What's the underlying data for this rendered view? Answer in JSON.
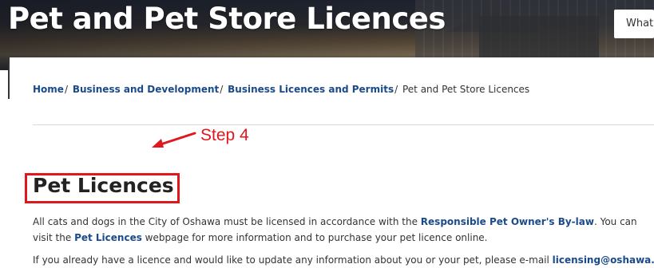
{
  "hero": {
    "title": "Pet and Pet Store Licences"
  },
  "search": {
    "placeholder": "What"
  },
  "breadcrumb": {
    "items": [
      "Home",
      "Business and Development",
      "Business Licences and Permits"
    ],
    "current": "Pet and Pet Store Licences",
    "separator": "/"
  },
  "annotation": {
    "step_label": "Step 4",
    "color": "#e0171d"
  },
  "section": {
    "title": "Pet Licences",
    "para1": {
      "text_a": "All cats and dogs in the City of Oshawa must be licensed in accordance with the ",
      "link_a": "Responsible Pet Owner's By-law",
      "text_b": ". You can visit the ",
      "link_b": "Pet Licences",
      "text_c": " webpage for more information and to purchase your pet licence online."
    },
    "para2": {
      "text_a": "If you already have a licence and would like to update any information about you or your pet, please e-mail ",
      "link_a": "licensing@oshawa.ca",
      "text_b": "."
    }
  },
  "colors": {
    "link": "#1a4a8a",
    "text": "#333333"
  }
}
